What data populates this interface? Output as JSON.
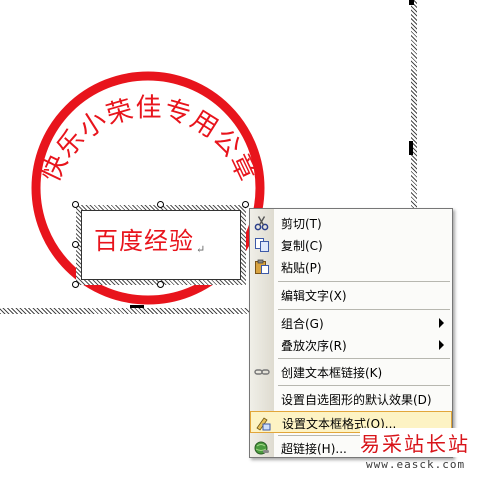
{
  "seal": {
    "circle_text": "快乐小荣佳专用公章",
    "color": "#e8141c"
  },
  "textbox": {
    "text": "百度经验",
    "paragraph_mark": "↵"
  },
  "context_menu": {
    "items": [
      {
        "label": "剪切(T)",
        "icon": "scissors-icon"
      },
      {
        "label": "复制(C)",
        "icon": "copy-icon"
      },
      {
        "label": "粘贴(P)",
        "icon": "paste-icon"
      },
      {
        "label": "编辑文字(X)"
      },
      {
        "label": "组合(G)",
        "submenu": true
      },
      {
        "label": "叠放次序(R)",
        "submenu": true
      },
      {
        "label": "创建文本框链接(K)",
        "icon": "chain-link-icon"
      },
      {
        "label": "设置自选图形的默认效果(D)"
      },
      {
        "label": "设置文本框格式(O)...",
        "icon": "format-textbox-icon",
        "highlighted": true
      },
      {
        "label": "超链接(H)...",
        "icon": "hyperlink-globe-icon"
      }
    ]
  },
  "watermark": {
    "title": "易采站长站",
    "url": "www.easck.com"
  }
}
